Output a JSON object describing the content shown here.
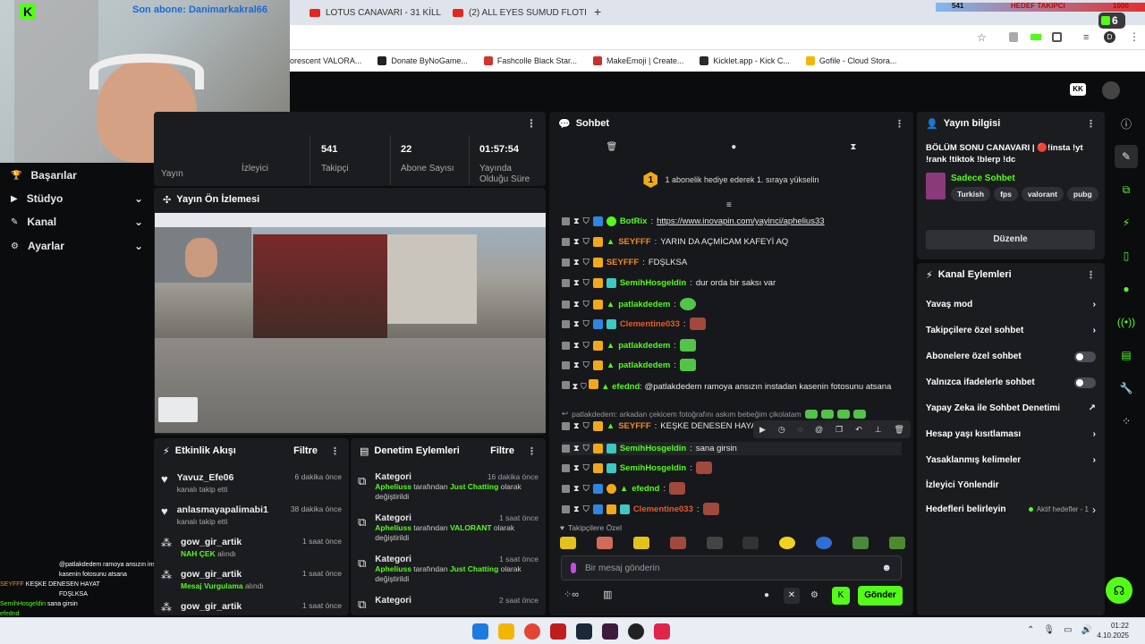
{
  "overlay": {
    "sub_text": "Son abone: Danimarkakral66",
    "goal_count": "541",
    "goal_label": "HEDEF TAKIPCI",
    "goal_target": "1000",
    "kick_logo": "K",
    "badge_number": "6"
  },
  "browser": {
    "tabs": [
      {
        "label": "LOTUS CANAVARI - 31 KİLL - Y"
      },
      {
        "label": "(2) ALL EYES SUMUD FLOTILLA"
      }
    ],
    "new_tab": "+",
    "bookmarks": [
      {
        "label": "lorescent VALORA...",
        "color": "#7b5cff"
      },
      {
        "label": "Donate ByNoGame...",
        "color": "#222222"
      },
      {
        "label": "Fashcolle Black Star...",
        "color": "#d0342c"
      },
      {
        "label": "MakeEmoji | Create...",
        "color": "#c9302c"
      },
      {
        "label": "Kicklet.app - Kick C...",
        "color": "#2b2b2b"
      },
      {
        "label": "Gofile - Cloud Stora...",
        "color": "#f2b705"
      }
    ]
  },
  "sidebar": {
    "items": [
      {
        "label": "Başarılar",
        "icon": "trophy-icon"
      },
      {
        "label": "Stüdyo",
        "icon": "studio-icon"
      },
      {
        "label": "Kanal",
        "icon": "channel-icon"
      },
      {
        "label": "Ayarlar",
        "icon": "gear-icon"
      }
    ]
  },
  "stats": [
    {
      "value": "",
      "label": "Yayın"
    },
    {
      "value": "",
      "label": "İzleyici"
    },
    {
      "value": "541",
      "label": "Takipçi"
    },
    {
      "value": "22",
      "label": "Abone Sayısı"
    },
    {
      "value": "01:57:54",
      "label": "Yayında Olduğu Süre"
    }
  ],
  "preview": {
    "title": "Yayın Ön İzlemesi"
  },
  "activity": {
    "title": "Etkinlik Akışı",
    "filter": "Filtre",
    "events": [
      {
        "name": "Yavuz_Efe06",
        "sub": "kanalı takip etti",
        "time": "6 dakika önce",
        "type": "follow"
      },
      {
        "name": "anlasmayapalimabi1",
        "sub": "kanalı takip etti",
        "time": "38 dakika önce",
        "type": "follow"
      },
      {
        "name": "gow_gir_artik",
        "sub_highlight": "NAH ÇEK",
        "sub": "alındı",
        "time": "1 saat önce",
        "type": "reward"
      },
      {
        "name": "gow_gir_artik",
        "sub_highlight": "Mesaj Vurgulama",
        "sub": "alındı",
        "time": "1 saat önce",
        "type": "reward"
      },
      {
        "name": "gow_gir_artik",
        "sub": "",
        "time": "1 saat önce",
        "type": "reward"
      }
    ]
  },
  "moderation": {
    "title": "Denetim Eylemleri",
    "filter": "Filtre",
    "items": [
      {
        "title": "Kategori",
        "time": "16 dakika önce",
        "user": "Apheliuss",
        "mid": "tarafından",
        "cat": "Just Chatting",
        "end": "olarak değiştirildi"
      },
      {
        "title": "Kategori",
        "time": "1 saat önce",
        "user": "Apheliuss",
        "mid": "tarafından",
        "cat": "VALORANT",
        "end": "olarak değiştirildi"
      },
      {
        "title": "Kategori",
        "time": "1 saat önce",
        "user": "Apheliuss",
        "mid": "tarafından",
        "cat": "Just Chatting",
        "end": "olarak değiştirildi"
      },
      {
        "title": "Kategori",
        "time": "2 saat önce"
      }
    ]
  },
  "chat": {
    "title": "Sohbet",
    "gift_notice": "1 abonelik hediye ederek 1. sıraya yükselin",
    "gift_rank": "1",
    "messages": [
      {
        "user": "BotRix",
        "color": "#53fc18",
        "text": "https://www.inovapin.com/yayinci/aphelius33",
        "link": true
      },
      {
        "user": "SEYFFF",
        "color": "#f08a24",
        "text": "YARIN DA AÇMİCAM KAFEYİ AQ"
      },
      {
        "user": "SEYFFF",
        "color": "#f08a24",
        "text": "FDŞLKSA"
      },
      {
        "user": "SemihHosgeldin",
        "color": "#53fc18",
        "text": "dur orda bir saksı var"
      },
      {
        "user": "patlakdedem",
        "color": "#53fc18",
        "text": ""
      },
      {
        "user": "Clementine033",
        "color": "#e25d2a",
        "text": ""
      },
      {
        "user": "patlakdedem",
        "color": "#53fc18",
        "text": ""
      },
      {
        "user": "patlakdedem",
        "color": "#53fc18",
        "text": ""
      },
      {
        "user": "efednd",
        "color": "#53fc18",
        "text": "@patlakdedem ramoya ansızın instadan kasenin fotosunu atsana"
      },
      {
        "user": "SEYFFF",
        "color": "#f08a24",
        "text": "KEŞKE DENESEN HAYAT"
      },
      {
        "user": "SemihHosgeldin",
        "color": "#53fc18",
        "text": "sana girsin"
      },
      {
        "user": "SemihHosgeldin",
        "color": "#53fc18",
        "text": ""
      },
      {
        "user": "efednd",
        "color": "#53fc18",
        "text": ""
      },
      {
        "user": "Clementine033",
        "color": "#e25d2a",
        "text": ""
      }
    ],
    "reply_preview": "patlakdedem: arkadan çekicem fotoğrafını askım bebeğim çikolatam",
    "followers_only": "Takipçilere Özel",
    "input_placeholder": "Bir mesaj gönderin",
    "send": "Gönder"
  },
  "stream_info": {
    "title": "Yayın bilgisi",
    "stream_title": "BÖLÜM SONU CANAVARI | 🔴!insta !yt !rank !tiktok !blerp !dc",
    "category": "Sadece Sohbet",
    "tags": [
      "Turkish",
      "fps",
      "valorant",
      "pubg"
    ],
    "edit": "Düzenle"
  },
  "channel_actions": {
    "title": "Kanal Eylemleri",
    "items": [
      {
        "label": "Yavaş mod",
        "control": "chevron"
      },
      {
        "label": "Takipçilere özel sohbet",
        "control": "chevron"
      },
      {
        "label": "Abonelere özel sohbet",
        "control": "toggle"
      },
      {
        "label": "Yalnızca ifadelerle sohbet",
        "control": "toggle"
      },
      {
        "label": "Yapay Zeka ile Sohbet Denetimi",
        "control": "external"
      },
      {
        "label": "Hesap yaşı kısıtlaması",
        "control": "chevron"
      },
      {
        "label": "Yasaklanmış kelimeler",
        "control": "chevron"
      },
      {
        "label": "İzleyici Yönlendir",
        "control": "none"
      },
      {
        "label": "Hedefleri belirleyin",
        "control": "chevron",
        "extra": "Aktif hedefler - 1"
      }
    ]
  },
  "taskbar": {
    "time": "01:22",
    "date": "4.10.2025"
  },
  "colors": {
    "accent": "#53fc18",
    "panel": "#1b1c1f",
    "bg": "#0b0c0e"
  }
}
